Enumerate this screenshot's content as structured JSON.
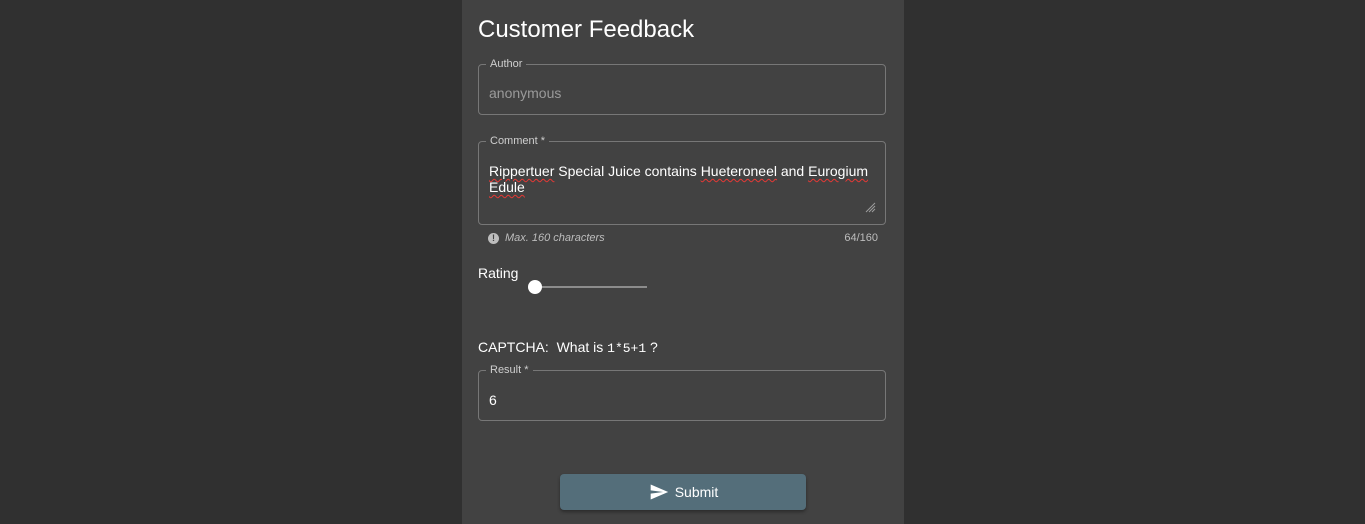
{
  "form": {
    "title": "Customer Feedback",
    "author": {
      "label": "Author",
      "value": "anonymous"
    },
    "comment": {
      "label": "Comment *",
      "words": [
        "Rippertuer",
        " Special Juice contains ",
        "Hueteroneel",
        " and ",
        "Eurogium",
        " ",
        "Edule"
      ],
      "hint": "Max. 160 characters",
      "counter": "64/160"
    },
    "rating": {
      "label": "Rating",
      "value": 0
    },
    "captcha": {
      "prefix": "CAPTCHA:  What is ",
      "expression": "1*5+1",
      "suffix": " ?"
    },
    "result": {
      "label": "Result *",
      "value": "6"
    },
    "submit": {
      "label": "Submit"
    }
  },
  "icons": {
    "hint": "exclamation-circle-icon",
    "submit": "send-icon",
    "resize": "resize-grip-icon"
  },
  "colors": {
    "background": "#303030",
    "card": "#424242",
    "submit_button": "#546e7a",
    "spellcheck": "#e53935"
  }
}
